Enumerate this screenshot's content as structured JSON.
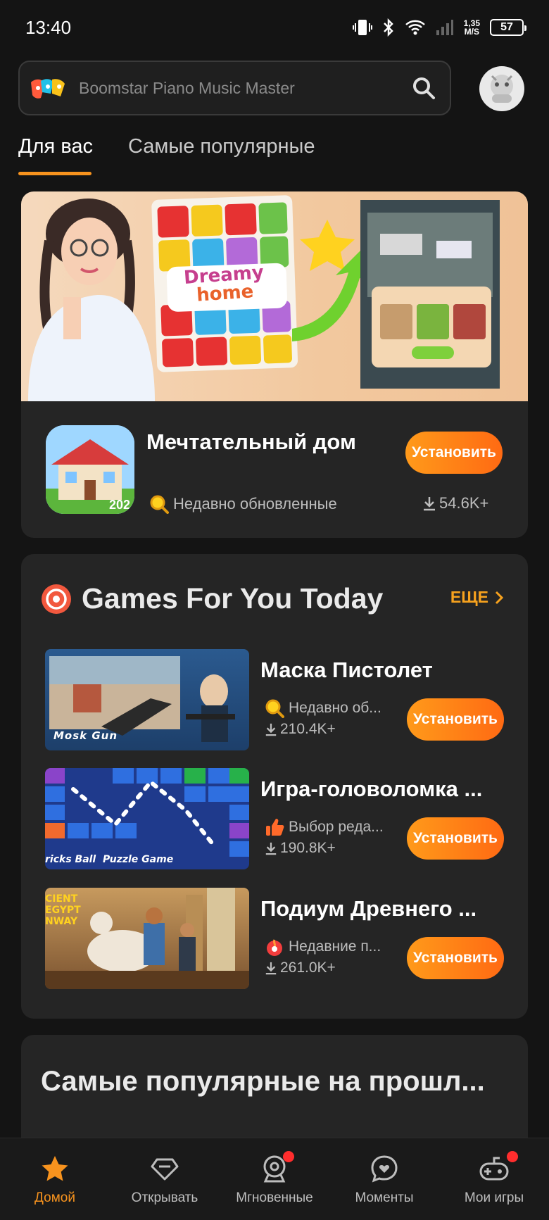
{
  "status_bar": {
    "time": "13:40",
    "speed_value": "1,35",
    "speed_unit": "M/S",
    "battery": "57",
    "icons": [
      "vibrate-icon",
      "bluetooth-icon",
      "wifi-icon",
      "signal-icon"
    ]
  },
  "search": {
    "placeholder": "Boomstar Piano Music Master"
  },
  "tabs": [
    {
      "label": "Для вас",
      "active": true
    },
    {
      "label": "Самые популярные",
      "active": false
    }
  ],
  "featured": {
    "banner_text_1": "Dreamy",
    "banner_text_2": "home",
    "title": "Мечтательный дом",
    "tag": "Недавно обновленные",
    "downloads": "54.6K+",
    "install_label": "Установить",
    "icon_year": "202"
  },
  "games_for_you": {
    "title": "Games For You Today",
    "more_label": "ЕЩЕ",
    "games": [
      {
        "title": "Маска Пистолет",
        "tag": "Недавно об...",
        "downloads": "210.4K+",
        "install_label": "Установить",
        "thumb_text": "Mosk Gun"
      },
      {
        "title": "Игра-головоломка ...",
        "tag": "Выбор реда...",
        "downloads": "190.8K+",
        "install_label": "Установить",
        "thumb_text": "ricks Ball  Puzzle Game"
      },
      {
        "title": "Подиум Древнего ...",
        "tag": "Недавние п...",
        "downloads": "261.0K+",
        "install_label": "Установить",
        "thumb_text": "CIENT EGYPT NWAY"
      }
    ]
  },
  "popular": {
    "title": "Самые популярные на прошл..."
  },
  "bottom_nav": [
    {
      "label": "Домой",
      "icon": "star-icon",
      "active": true,
      "badge": false
    },
    {
      "label": "Открывать",
      "icon": "diamond-icon",
      "active": false,
      "badge": false
    },
    {
      "label": "Мгновенные",
      "icon": "instant-icon",
      "active": false,
      "badge": true
    },
    {
      "label": "Моменты",
      "icon": "moments-icon",
      "active": false,
      "badge": false
    },
    {
      "label": "Мои игры",
      "icon": "gamepad-icon",
      "active": false,
      "badge": true
    }
  ],
  "colors": {
    "accent": "#f7931e",
    "background": "#141414",
    "card": "#252525",
    "badge": "#ff2d2d"
  }
}
